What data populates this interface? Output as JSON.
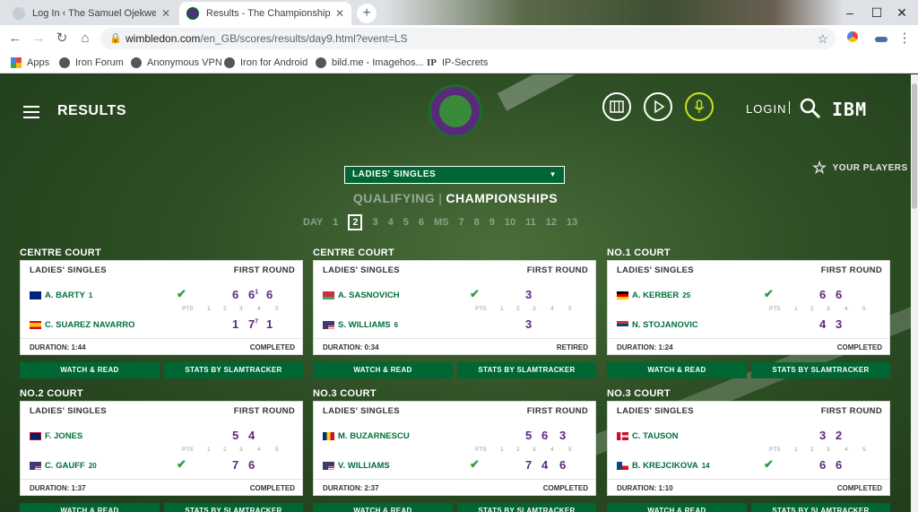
{
  "browser": {
    "tabs": [
      {
        "title": "Log In ‹ The Samuel Ojekwe Blog",
        "close": "✕"
      },
      {
        "title": "Results - The Championships, Wi",
        "close": "✕"
      }
    ],
    "new_tab": "+",
    "url_host": "wimbledon.com",
    "url_path": "/en_GB/scores/results/day9.html?event=LS",
    "bookmarks": [
      "Apps",
      "Iron Forum",
      "Anonymous VPN",
      "Iron for Android",
      "bild.me - Imagehos...",
      "IP-Secrets"
    ],
    "bookmark_ip_prefix": "IP"
  },
  "header": {
    "title": "RESULTS",
    "login": "LOGIN",
    "ibm": "IBM",
    "logo_text": "THE CHAMPIONSHIPS · WIMBLEDON"
  },
  "your_players": "YOUR PLAYERS",
  "event_dropdown": "LADIES' SINGLES",
  "tabs": {
    "qualifying": "QUALIFYING",
    "divider": "|",
    "championships": "CHAMPIONSHIPS"
  },
  "days": {
    "label": "DAY",
    "items": [
      "1",
      "2",
      "3",
      "4",
      "5",
      "6",
      "MS",
      "7",
      "8",
      "9",
      "10",
      "11",
      "12",
      "13"
    ],
    "selected": "2"
  },
  "set_labels": [
    "PTS",
    "1",
    "2",
    "3",
    "4",
    "5"
  ],
  "buttons": {
    "watch": "WATCH & READ",
    "stats": "STATS BY SLAMTRACKER"
  },
  "matches": [
    {
      "court": "CENTRE COURT",
      "event": "LADIES' SINGLES",
      "round": "FIRST ROUND",
      "p1": {
        "name": "A. BARTY",
        "seed": "1",
        "flag": "aus",
        "scores": [
          "6",
          "6",
          "6"
        ],
        "tb": [
          "",
          "1",
          ""
        ],
        "winner": true
      },
      "p2": {
        "name": "C. SUAREZ NAVARRO",
        "seed": "",
        "flag": "esp",
        "scores": [
          "1",
          "7",
          "1"
        ],
        "tb": [
          "",
          "7",
          ""
        ],
        "winner": false
      },
      "duration": "DURATION: 1:44",
      "status": "COMPLETED"
    },
    {
      "court": "CENTRE COURT",
      "event": "LADIES' SINGLES",
      "round": "FIRST ROUND",
      "p1": {
        "name": "A. SASNOVICH",
        "seed": "",
        "flag": "blr",
        "scores": [
          "3"
        ],
        "tb": [
          ""
        ],
        "winner": true
      },
      "p2": {
        "name": "S. WILLIAMS",
        "seed": "6",
        "flag": "usa",
        "scores": [
          "3"
        ],
        "tb": [
          ""
        ],
        "winner": false
      },
      "duration": "DURATION: 0:34",
      "status": "RETIRED"
    },
    {
      "court": "NO.1 COURT",
      "event": "LADIES' SINGLES",
      "round": "FIRST ROUND",
      "p1": {
        "name": "A. KERBER",
        "seed": "25",
        "flag": "ger",
        "scores": [
          "6",
          "6"
        ],
        "tb": [
          "",
          ""
        ],
        "winner": true
      },
      "p2": {
        "name": "N. STOJANOVIC",
        "seed": "",
        "flag": "srb",
        "scores": [
          "4",
          "3"
        ],
        "tb": [
          "",
          ""
        ],
        "winner": false
      },
      "duration": "DURATION: 1:24",
      "status": "COMPLETED"
    },
    {
      "court": "NO.2 COURT",
      "event": "LADIES' SINGLES",
      "round": "FIRST ROUND",
      "p1": {
        "name": "F. JONES",
        "seed": "",
        "flag": "gbr",
        "scores": [
          "5",
          "4"
        ],
        "tb": [
          "",
          ""
        ],
        "winner": false
      },
      "p2": {
        "name": "C. GAUFF",
        "seed": "20",
        "flag": "usa",
        "scores": [
          "7",
          "6"
        ],
        "tb": [
          "",
          ""
        ],
        "winner": true
      },
      "duration": "DURATION: 1:37",
      "status": "COMPLETED"
    },
    {
      "court": "NO.3 COURT",
      "event": "LADIES' SINGLES",
      "round": "FIRST ROUND",
      "p1": {
        "name": "M. BUZARNESCU",
        "seed": "",
        "flag": "rou",
        "scores": [
          "5",
          "6",
          "3"
        ],
        "tb": [
          "",
          "",
          ""
        ],
        "winner": false
      },
      "p2": {
        "name": "V. WILLIAMS",
        "seed": "",
        "flag": "usa",
        "scores": [
          "7",
          "4",
          "6"
        ],
        "tb": [
          "",
          "",
          ""
        ],
        "winner": true
      },
      "duration": "DURATION: 2:37",
      "status": "COMPLETED"
    },
    {
      "court": "NO.3 COURT",
      "event": "LADIES' SINGLES",
      "round": "FIRST ROUND",
      "p1": {
        "name": "C. TAUSON",
        "seed": "",
        "flag": "den",
        "scores": [
          "3",
          "2"
        ],
        "tb": [
          "",
          ""
        ],
        "winner": false
      },
      "p2": {
        "name": "B. KREJCIKOVA",
        "seed": "14",
        "flag": "cze",
        "scores": [
          "6",
          "6"
        ],
        "tb": [
          "",
          ""
        ],
        "winner": true
      },
      "duration": "DURATION: 1:10",
      "status": "COMPLETED"
    }
  ],
  "colors": {
    "brand_green": "#006633",
    "brand_purple": "#5a2a82",
    "score_purple": "#5a2a82",
    "name_green": "#00703c"
  }
}
